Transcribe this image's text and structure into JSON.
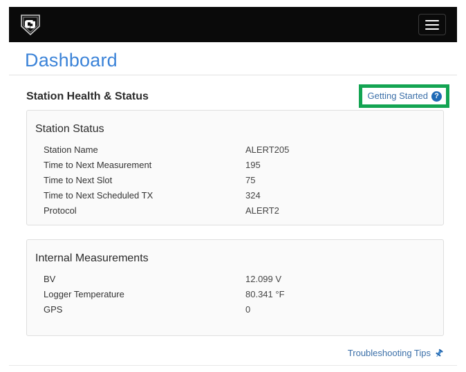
{
  "navbar": {
    "logo_name": "campbell-scientific-shield-logo",
    "menu_button_label": "",
    "menu_icon": "hamburger-menu-icon"
  },
  "page": {
    "title": "Dashboard"
  },
  "section": {
    "title": "Station Health & Status",
    "getting_started_label": "Getting Started",
    "help_icon_glyph": "?",
    "highlight_color": "#13a452"
  },
  "panels": [
    {
      "title": "Station Status",
      "rows": [
        {
          "label": "Station Name",
          "value": "ALERT205"
        },
        {
          "label": "Time to Next Measurement",
          "value": "195"
        },
        {
          "label": "Time to Next Slot",
          "value": "75"
        },
        {
          "label": "Time to Next Scheduled TX",
          "value": "324"
        },
        {
          "label": "Protocol",
          "value": "ALERT2"
        }
      ]
    },
    {
      "title": "Internal Measurements",
      "rows": [
        {
          "label": "BV",
          "value": "12.099 V"
        },
        {
          "label": "Logger Temperature",
          "value": "80.341 °F"
        },
        {
          "label": "GPS",
          "value": "0"
        }
      ]
    }
  ],
  "footer": {
    "troubleshooting_label": "Troubleshooting Tips",
    "pin_icon": "pushpin-icon"
  },
  "colors": {
    "navbar_bg": "#0a0a0a",
    "title_blue": "#3b83d8",
    "link_blue": "#3b6fa8",
    "panel_bg": "#fafafa",
    "panel_border": "#dedede",
    "highlight_green": "#13a452"
  }
}
